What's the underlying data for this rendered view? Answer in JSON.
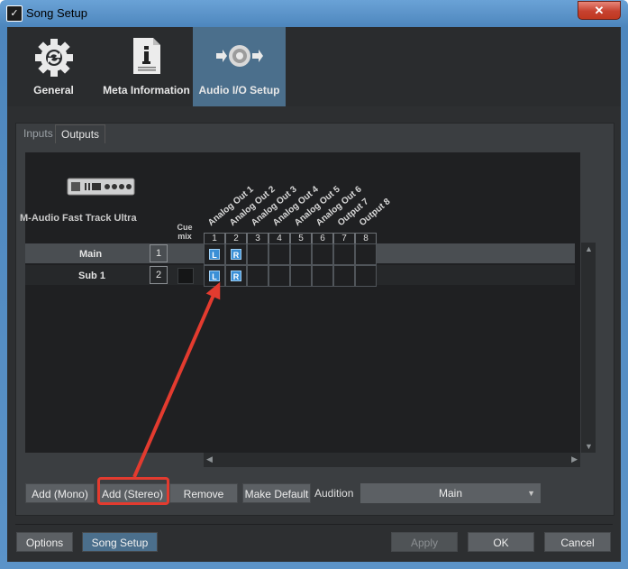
{
  "window": {
    "title": "Song Setup",
    "close_glyph": "✕"
  },
  "top_tabs": [
    {
      "label": "General",
      "icon": "gear-icon"
    },
    {
      "label": "Meta Information",
      "icon": "document-icon"
    },
    {
      "label": "Audio I/O Setup",
      "icon": "speaker-io-icon",
      "selected": true
    }
  ],
  "sub_tabs": [
    {
      "label": "Inputs",
      "selected": false
    },
    {
      "label": "Outputs",
      "selected": true
    }
  ],
  "device": {
    "name": "M-Audio Fast Track Ultra",
    "icon": "audio-interface-icon"
  },
  "cue_mix_label": "Cue mix",
  "channels": [
    {
      "num": "1",
      "name": "Analog Out 1"
    },
    {
      "num": "2",
      "name": "Analog Out 2"
    },
    {
      "num": "3",
      "name": "Analog Out 3"
    },
    {
      "num": "4",
      "name": "Analog Out 4"
    },
    {
      "num": "5",
      "name": "Analog Out 5"
    },
    {
      "num": "6",
      "name": "Analog Out 6"
    },
    {
      "num": "7",
      "name": "Output 7"
    },
    {
      "num": "8",
      "name": "Output 8"
    }
  ],
  "rows": [
    {
      "label": "Main",
      "num": "1",
      "pins": [
        "L",
        "R"
      ]
    },
    {
      "label": "Sub 1",
      "num": "2",
      "pins": [
        "L",
        "R"
      ]
    }
  ],
  "bottom_buttons": {
    "add_mono": "Add (Mono)",
    "add_stereo": "Add (Stereo)",
    "remove": "Remove",
    "make_default": "Make Default"
  },
  "audition": {
    "label": "Audition",
    "value": "Main"
  },
  "footer": {
    "options": "Options",
    "song_setup": "Song Setup",
    "apply": "Apply",
    "ok": "OK",
    "cancel": "Cancel"
  },
  "colors": {
    "accent": "#4b6f8c",
    "pin": "#3a8fd6",
    "annotation": "#e33b2f"
  }
}
